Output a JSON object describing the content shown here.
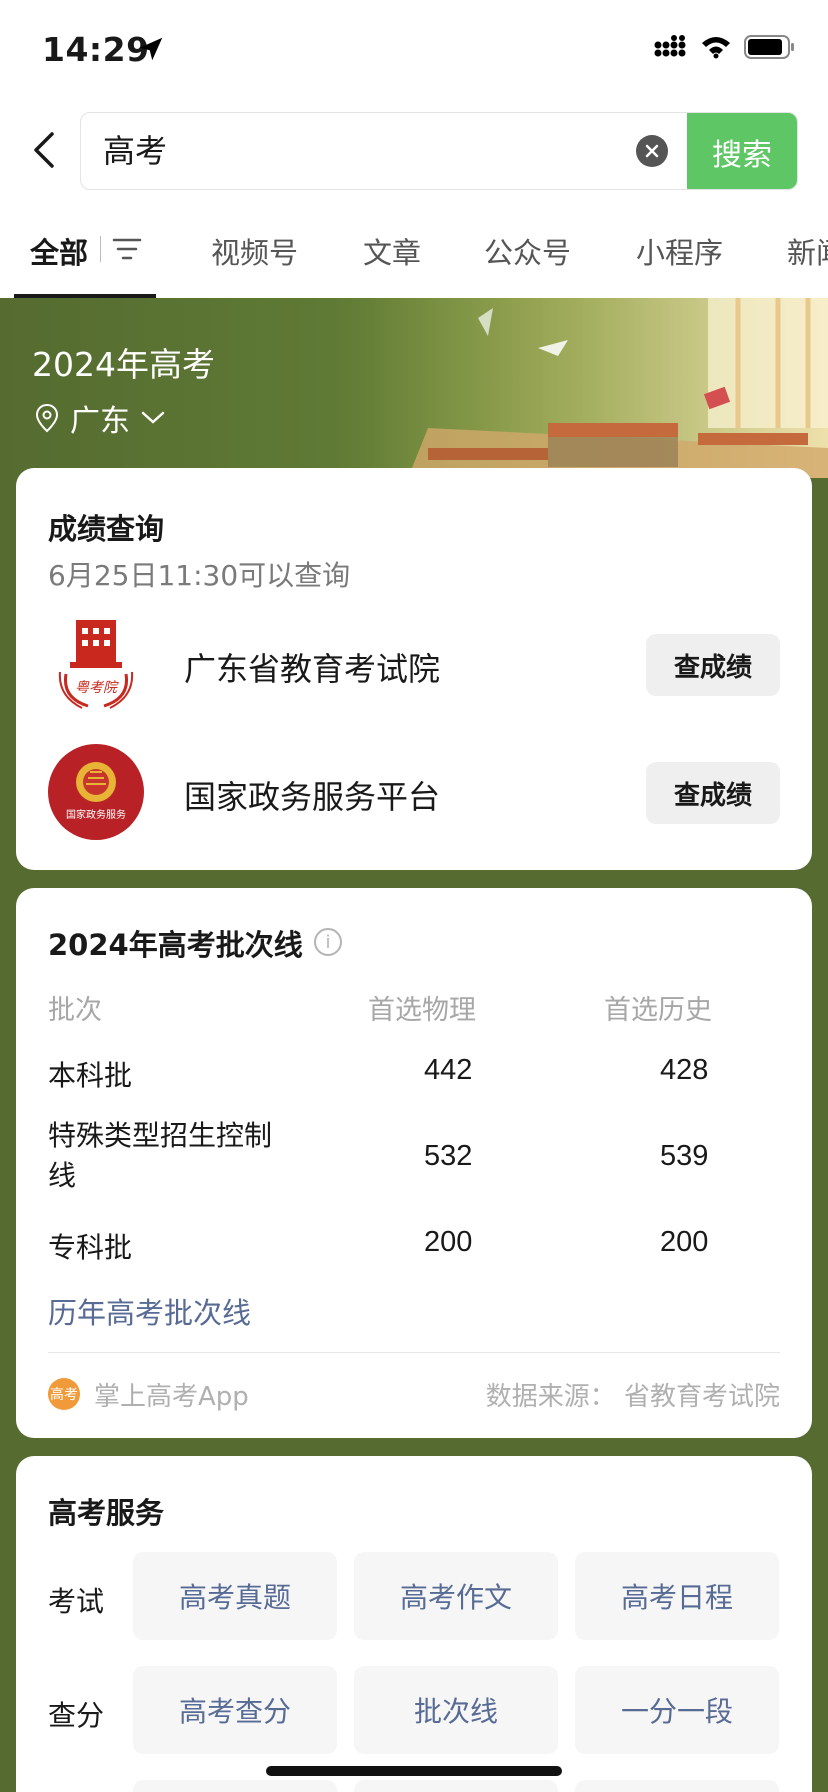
{
  "status": {
    "time": "14:29"
  },
  "search": {
    "query": "高考",
    "button_label": "搜索"
  },
  "tabs": [
    {
      "label": "全部",
      "active": true
    },
    {
      "label": "视频号"
    },
    {
      "label": "文章"
    },
    {
      "label": "公众号"
    },
    {
      "label": "小程序"
    },
    {
      "label": "新闻"
    }
  ],
  "banner": {
    "title": "2024年高考",
    "location": "广东"
  },
  "score_query": {
    "title": "成绩查询",
    "subtitle": "6月25日11:30可以查询",
    "providers": [
      {
        "name": "广东省教育考试院",
        "button": "查成绩",
        "logo_text": "粤考院"
      },
      {
        "name": "国家政务服务平台",
        "button": "查成绩",
        "logo_text": "国家政务服务"
      }
    ]
  },
  "cutoff": {
    "title": "2024年高考批次线",
    "columns": [
      "批次",
      "首选物理",
      "首选历史"
    ],
    "rows": [
      {
        "name": "本科批",
        "physics": "442",
        "history": "428"
      },
      {
        "name": "特殊类型招生控制",
        "name2": "线",
        "physics": "532",
        "history": "539"
      },
      {
        "name": "专科批",
        "physics": "200",
        "history": "200"
      }
    ],
    "history_link": "历年高考批次线",
    "app_name": "掌上高考App",
    "app_logo_text": "高考",
    "source": "数据来源：  省教育考试院"
  },
  "services": {
    "title": "高考服务",
    "groups": [
      {
        "category": "考试",
        "items": [
          "高考真题",
          "高考作文",
          "高考日程"
        ]
      },
      {
        "category": "查分",
        "items": [
          "高考查分",
          "批次线",
          "一分一段"
        ]
      }
    ]
  }
}
